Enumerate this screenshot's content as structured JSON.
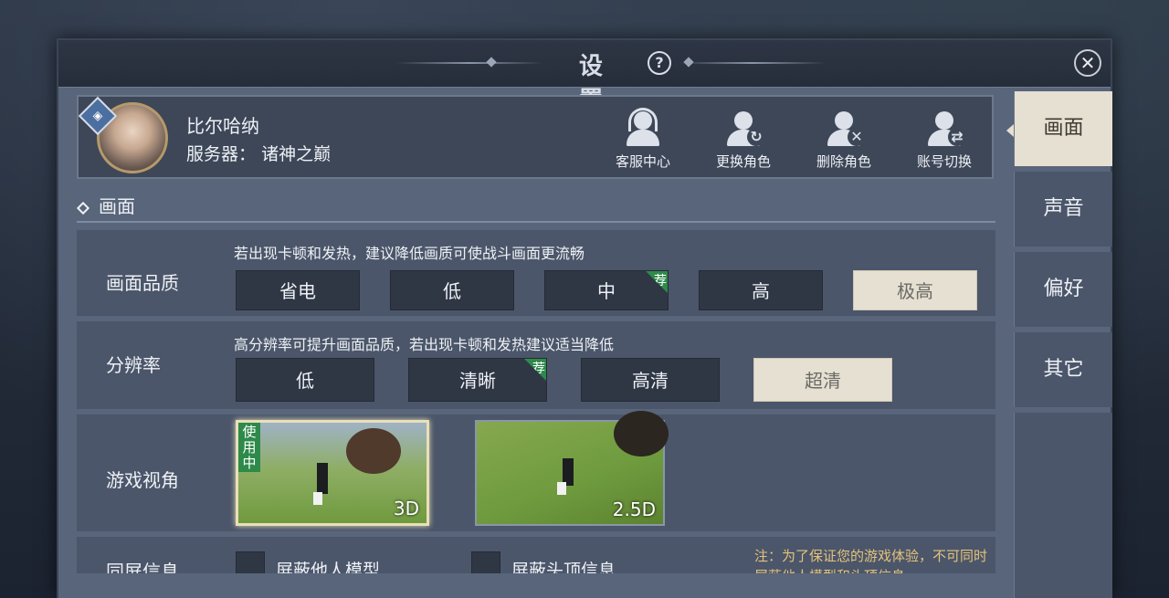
{
  "window": {
    "title": "设 置",
    "help_glyph": "?",
    "close_glyph": "✕"
  },
  "profile": {
    "name": "比尔哈纳",
    "server_label": "服务器：",
    "server_name": "诸神之巅",
    "actions": [
      {
        "label": "客服中心",
        "icon": "headset-icon"
      },
      {
        "label": "更换角色",
        "icon": "switch-character-icon"
      },
      {
        "label": "删除角色",
        "icon": "delete-character-icon"
      },
      {
        "label": "账号切换",
        "icon": "switch-account-icon"
      }
    ]
  },
  "section": {
    "title": "画面"
  },
  "quality": {
    "label": "画面品质",
    "hint": "若出现卡顿和发热，建议降低画质可使战斗画面更流畅",
    "options": [
      "省电",
      "低",
      "中",
      "高",
      "极高"
    ],
    "recommended": "中",
    "selected": "极高",
    "rec_tag": "荐"
  },
  "resolution": {
    "label": "分辨率",
    "hint": "高分辨率可提升画面品质，若出现卡顿和发热建议适当降低",
    "options": [
      "低",
      "清晰",
      "高清",
      "超清"
    ],
    "recommended": "清晰",
    "selected": "超清",
    "rec_tag": "荐"
  },
  "camera": {
    "label": "游戏视角",
    "options": [
      "3D",
      "2.5D"
    ],
    "selected": "3D",
    "inuse_tag": "使用中"
  },
  "onscreen": {
    "label": "同屏信息",
    "checkboxes": [
      "屏蔽他人模型",
      "屏蔽头顶信息"
    ],
    "note": "注：为了保证您的游戏体验，不可同时屏蔽他人模型和头顶信息"
  },
  "tabs": [
    "画面",
    "声音",
    "偏好",
    "其它"
  ],
  "active_tab": "画面",
  "colors": {
    "selected": "#e6e0d2",
    "recommended": "#2e8a4a",
    "note": "#e4c27a"
  }
}
